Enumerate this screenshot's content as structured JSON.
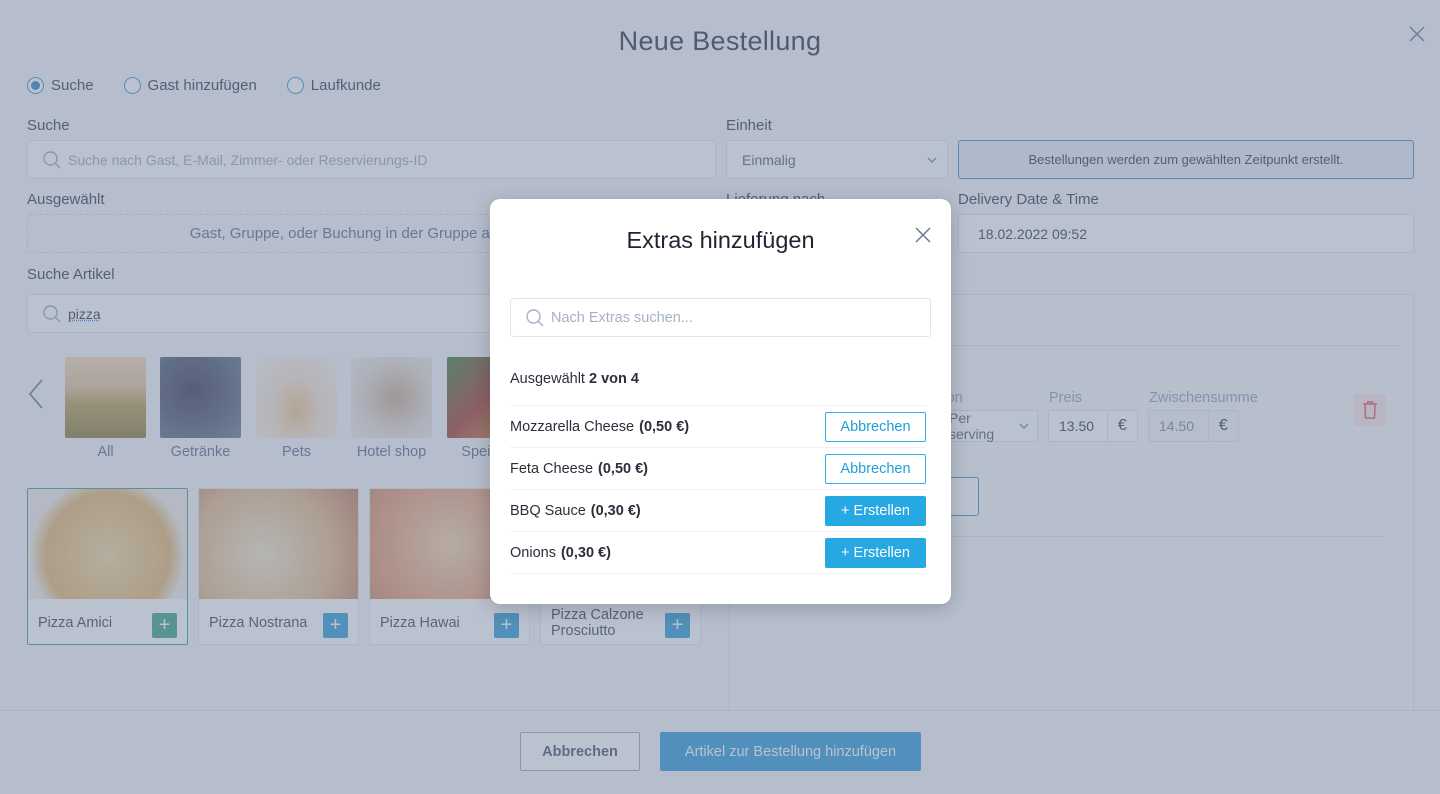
{
  "page": {
    "title": "Neue Bestellung",
    "close_icon": "close-icon"
  },
  "mode": {
    "options": [
      {
        "label": "Suche",
        "selected": true
      },
      {
        "label": "Gast hinzufügen",
        "selected": false
      },
      {
        "label": "Laufkunde",
        "selected": false
      }
    ]
  },
  "guest_search": {
    "label": "Suche",
    "placeholder": "Suche nach Gast, E-Mail, Zimmer- oder Reservierungs-ID",
    "icon": "search-icon"
  },
  "selected": {
    "label": "Ausgewählt",
    "placeholder": "Gast, Gruppe, oder Buchung in der Gruppe auswählen"
  },
  "unit": {
    "label": "Einheit",
    "value": "Einmalig",
    "info": "Bestellungen werden zum gewählten Zeitpunkt erstellt."
  },
  "delivery": {
    "to_label": "Lieferung nach",
    "datetime_label": "Delivery Date & Time",
    "datetime_value": "18.02.2022 09:52"
  },
  "article_search": {
    "label": "Suche Artikel",
    "value": "pizza",
    "icon": "search-icon"
  },
  "categories": [
    {
      "label": "All",
      "color": "#b79a5e"
    },
    {
      "label": "Getränke",
      "color": "#3d4a66"
    },
    {
      "label": "Pets",
      "color": "#e8dccb"
    },
    {
      "label": "Hotel shop",
      "color": "#d9cdbd"
    },
    {
      "label": "Speisen",
      "color": "#5b7a3c"
    }
  ],
  "products": [
    {
      "name": "Pizza Amici",
      "selected": true,
      "color": "#e8c58a"
    },
    {
      "name": "Pizza Nostrana",
      "selected": false,
      "color": "#e9d3b0"
    },
    {
      "name": "Pizza Hawai",
      "selected": false,
      "color": "#eac39a"
    },
    {
      "name": "Pizza Calzone Prosciutto",
      "selected": false,
      "color": "#d9b48a"
    }
  ],
  "order_line": {
    "option_label": "Option",
    "option_value": "Per serving",
    "price_label": "Preis",
    "price_value": "13.50",
    "subtotal_label": "Zwischensumme",
    "subtotal_value": "14.50",
    "currency": "€"
  },
  "footer": {
    "cancel_label": "Abbrechen",
    "submit_label": "Artikel zur Bestellung hinzufügen"
  },
  "modal": {
    "title": "Extras hinzufügen",
    "search_placeholder": "Nach Extras suchen...",
    "count_prefix": "Ausgewählt",
    "count_value": "2 von 4",
    "extras": [
      {
        "name": "Mozzarella Cheese",
        "price": "(0,50 €)",
        "action": "Abbrechen",
        "selected": true
      },
      {
        "name": "Feta Cheese",
        "price": "(0,50 €)",
        "action": "Abbrechen",
        "selected": true
      },
      {
        "name": "BBQ Sauce",
        "price": "(0,30 €)",
        "action": "+ Erstellen",
        "selected": false
      },
      {
        "name": "Onions",
        "price": "(0,30 €)",
        "action": "+ Erstellen",
        "selected": false
      }
    ]
  }
}
